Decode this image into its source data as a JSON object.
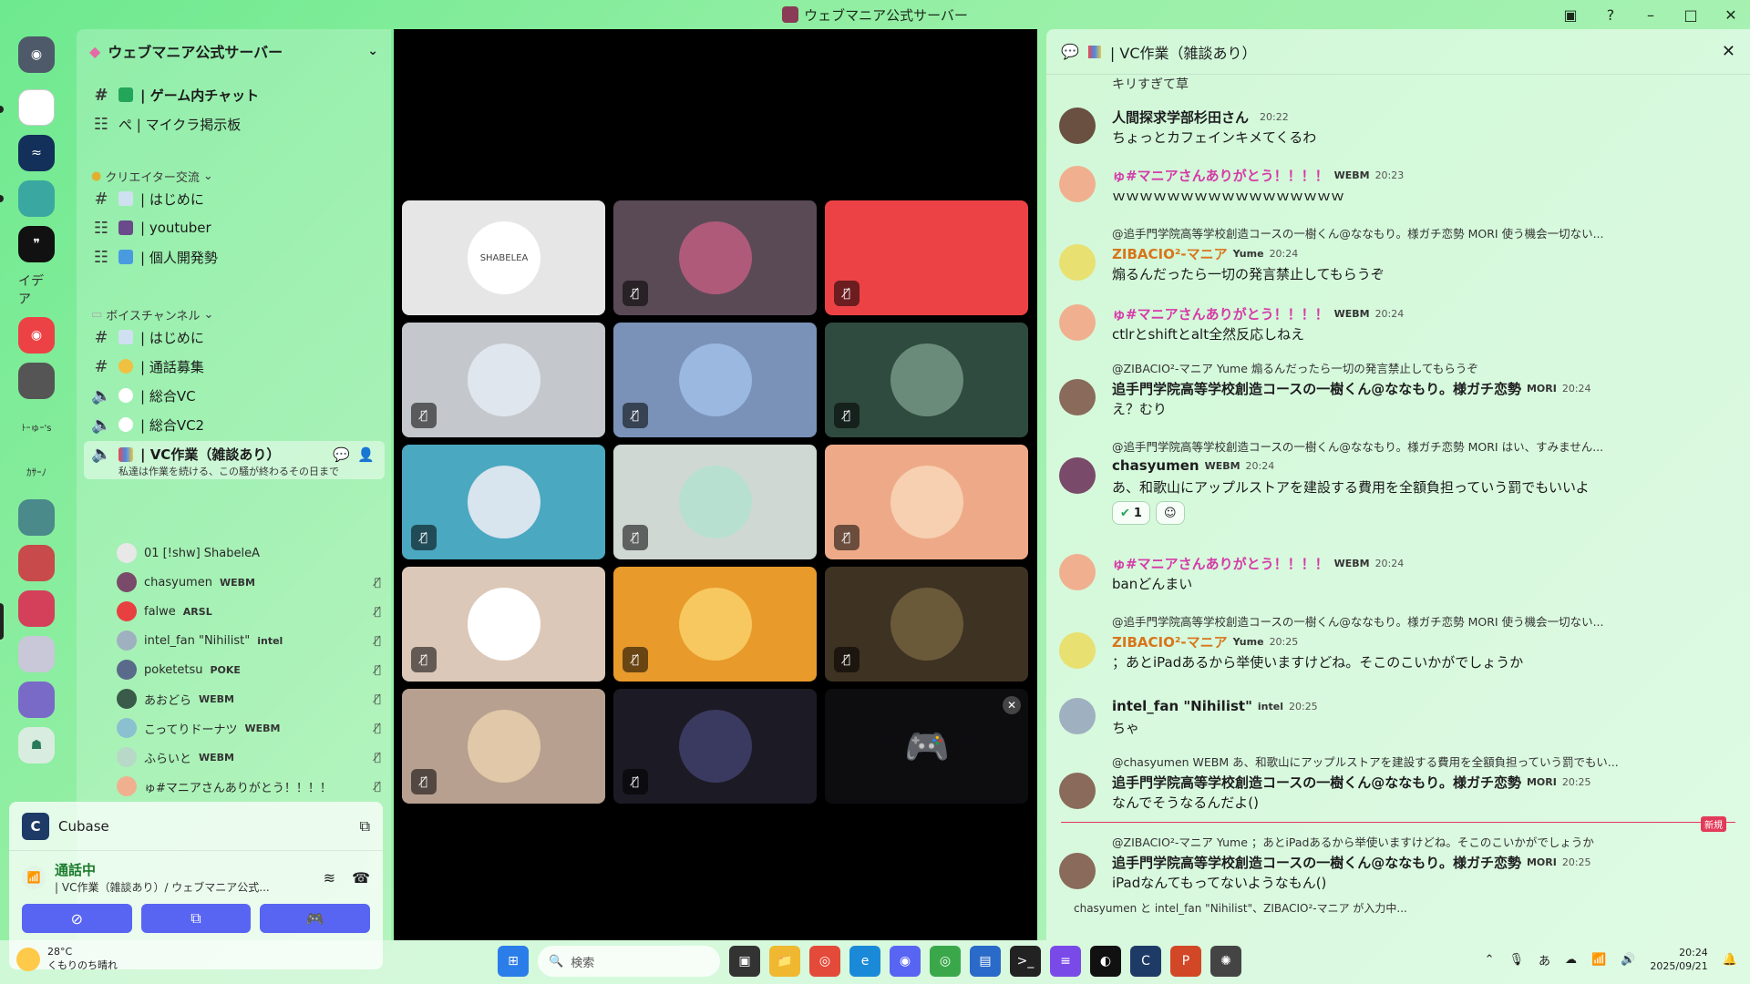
{
  "window": {
    "title": "ウェブマニア公式サーバー"
  },
  "server": {
    "name": "ウェブマニア公式サーバー"
  },
  "channels": {
    "top": [
      {
        "label": "| ゲーム内チャット",
        "bold": true
      },
      {
        "label": "ぺ | マイクラ掲示板"
      }
    ],
    "creator_category": "クリエイター交流",
    "creator": [
      {
        "label": "| はじめに"
      },
      {
        "label": "| youtuber"
      },
      {
        "label": "| 個人開発勢"
      }
    ],
    "voice_category": "ボイスチャンネル",
    "voice": [
      {
        "label": "| はじめに"
      },
      {
        "label": "| 通話募集"
      },
      {
        "label": "| 総合VC"
      },
      {
        "label": "| 総合VC2"
      }
    ],
    "active": {
      "label": "| VC作業（雑談あり）",
      "desc": "私達は作業を続ける、この騒が終わるその日まで"
    }
  },
  "members": [
    {
      "name": "01 [!shw] ShabeleA",
      "tag": "",
      "color": "#e8e8e8"
    },
    {
      "name": "chasyumen",
      "tag": "WEBM",
      "color": "#7a4a6a"
    },
    {
      "name": "falwe",
      "tag": "ARSL",
      "color": "#e84040"
    },
    {
      "name": "intel_fan \"Nihilist\"",
      "tag": "intel",
      "color": "#9fb0c0"
    },
    {
      "name": "poketetsu",
      "tag": "POKE",
      "color": "#5a6a8a"
    },
    {
      "name": "あおどら",
      "tag": "WEBM",
      "color": "#3a5a4a"
    },
    {
      "name": "こってりドーナツ",
      "tag": "WEBM",
      "color": "#8ac0d0"
    },
    {
      "name": "ふらいと",
      "tag": "WEBM",
      "color": "#b8d8c8"
    },
    {
      "name": "ゅ#マニアさんありがとう！！！！",
      "tag": "",
      "color": "#f0b090"
    }
  ],
  "voice_panel": {
    "app": "Cubase",
    "status": "通話中",
    "location": "| VC作業（雑談あり）/ ウェブマニア公式..."
  },
  "tiles": [
    {
      "bg": "#e6e6e6",
      "av": "#ffffff",
      "label": "SHABELEA",
      "muted": false
    },
    {
      "bg": "#5a4a56",
      "av": "#b05a7a",
      "label": "",
      "muted": true
    },
    {
      "bg": "#ed4245",
      "av": "#ed4245",
      "label": "",
      "muted": true
    },
    {
      "bg": "#c4c8cc",
      "av": "#dfe6ee",
      "label": "",
      "muted": true
    },
    {
      "bg": "#7a92b8",
      "av": "#9ab8e0",
      "label": "",
      "muted": true
    },
    {
      "bg": "#2f4a3e",
      "av": "#6a8a7a",
      "label": "",
      "muted": true
    },
    {
      "bg": "#4aa8c0",
      "av": "#d8e4ee",
      "label": "",
      "muted": true
    },
    {
      "bg": "#cfd8d2",
      "av": "#b8e0d0",
      "label": "",
      "muted": true
    },
    {
      "bg": "#eeaa88",
      "av": "#f6d0b0",
      "label": "",
      "muted": true
    },
    {
      "bg": "#dcc8b8",
      "av": "#ffffff",
      "label": "",
      "muted": true
    },
    {
      "bg": "#e89a2a",
      "av": "#f8c860",
      "label": "",
      "muted": true
    },
    {
      "bg": "#3e3222",
      "av": "#6a5a3a",
      "label": "",
      "muted": true
    },
    {
      "bg": "#b8a090",
      "av": "#e0c8a8",
      "label": "",
      "muted": true
    },
    {
      "bg": "#1c1a24",
      "av": "#3a3a60",
      "label": "",
      "muted": true
    },
    {
      "bg": "#0d0d10",
      "av": "#0d0d10",
      "label": "🎮",
      "muted": false,
      "close": true
    }
  ],
  "chat": {
    "header": "| VC作業（雑談あり）",
    "top_snippet": "キリすぎて草",
    "messages": [
      {
        "name": "人間探求学部杉田さん",
        "time": "20:22",
        "body": "ちょっとカフェインキメてくるわ",
        "nameclass": "",
        "tag": "",
        "reply": "",
        "color": "#6a5040"
      },
      {
        "name": "ゅ#マニアさんありがとう！！！！",
        "time": "20:23",
        "body": "ｗｗｗｗｗｗｗｗｗｗｗｗｗｗｗｗｗ",
        "nameclass": "pink",
        "tag": "WEBM",
        "reply": "",
        "color": "#f0b090"
      },
      {
        "name": "ZIBACIO²-マニア",
        "time": "20:24",
        "body": "煽るんだったら一切の発言禁止してもらうぞ",
        "nameclass": "orange",
        "tag": "Yume",
        "reply": "@追手門学院高等学校創造コースの一樹くん@ななもり。様ガチ恋勢 MORI 使う機会一切ない...",
        "color": "#e8e070"
      },
      {
        "name": "ゅ#マニアさんありがとう！！！！",
        "time": "20:24",
        "body": "ctlrとshiftとalt全然反応しねえ",
        "nameclass": "pink",
        "tag": "WEBM",
        "reply": "",
        "color": "#f0b090"
      },
      {
        "name": "追手門学院高等学校創造コースの一樹くん@ななもり。様ガチ恋勢",
        "time": "20:24",
        "body": "え？むり",
        "nameclass": "",
        "tag": "MORI",
        "reply": "@ZIBACIO²-マニア Yume 煽るんだったら一切の発言禁止してもらうぞ",
        "color": "#8a6a5a"
      },
      {
        "name": "chasyumen",
        "time": "20:24",
        "body": "あ、和歌山にアップルストアを建設する費用を全額負担っていう罰でもいいよ",
        "nameclass": "",
        "tag": "WEBM",
        "reply": "@追手門学院高等学校創造コースの一樹くん@ななもり。様ガチ恋勢 MORI はい、すみません...",
        "color": "#7a4a6a"
      },
      {
        "name": "ゅ#マニアさんありがとう！！！！",
        "time": "20:24",
        "body": "banどんまい",
        "nameclass": "pink",
        "tag": "WEBM",
        "reply": "",
        "color": "#f0b090"
      },
      {
        "name": "ZIBACIO²-マニア",
        "time": "20:25",
        "body": "；あとiPadあるから举使いますけどね。そこのこいかがでしょうか",
        "nameclass": "orange",
        "tag": "Yume",
        "reply": "@追手門学院高等学校創造コースの一樹くん@ななもり。様ガチ恋勢 MORI 使う機会一切ない...",
        "color": "#e8e070"
      },
      {
        "name": "intel_fan \"Nihilist\"",
        "time": "20:25",
        "body": "ちゃ",
        "nameclass": "",
        "tag": "intel",
        "reply": "",
        "color": "#9fb0c0"
      },
      {
        "name": "追手門学院高等学校創造コースの一樹くん@ななもり。様ガチ恋勢",
        "time": "20:25",
        "body": "なんでそうなるんだよ()",
        "nameclass": "",
        "tag": "MORI",
        "reply": "@chasyumen WEBM あ、和歌山にアップルストアを建設する費用を全額負担っていう罰でもい...",
        "color": "#8a6a5a"
      },
      {
        "name": "追手門学院高等学校創造コースの一樹くん@ななもり。様ガチ恋勢",
        "time": "20:25",
        "body": "iPadなんてもってないようなもん()",
        "nameclass": "",
        "tag": "MORI",
        "reply": "@ZIBACIO²-マニア Yume ；あとiPadあるから举使いますけどね。そこのこいかがでしょうか",
        "color": "#8a6a5a"
      }
    ],
    "reaction_count": "1",
    "new_badge": "新規",
    "typing": "chasyumen と intel_fan \"Nihilist\"、ZIBACIO²-マニア が入力中..."
  },
  "taskbar": {
    "temp": "28°C",
    "weather": "くもりのち晴れ",
    "search_placeholder": "検索",
    "time": "20:24",
    "date": "2025/09/21"
  },
  "colors": {
    "accent": "#5865f2",
    "green": "#23a55a",
    "pink": "#d63aa8"
  }
}
